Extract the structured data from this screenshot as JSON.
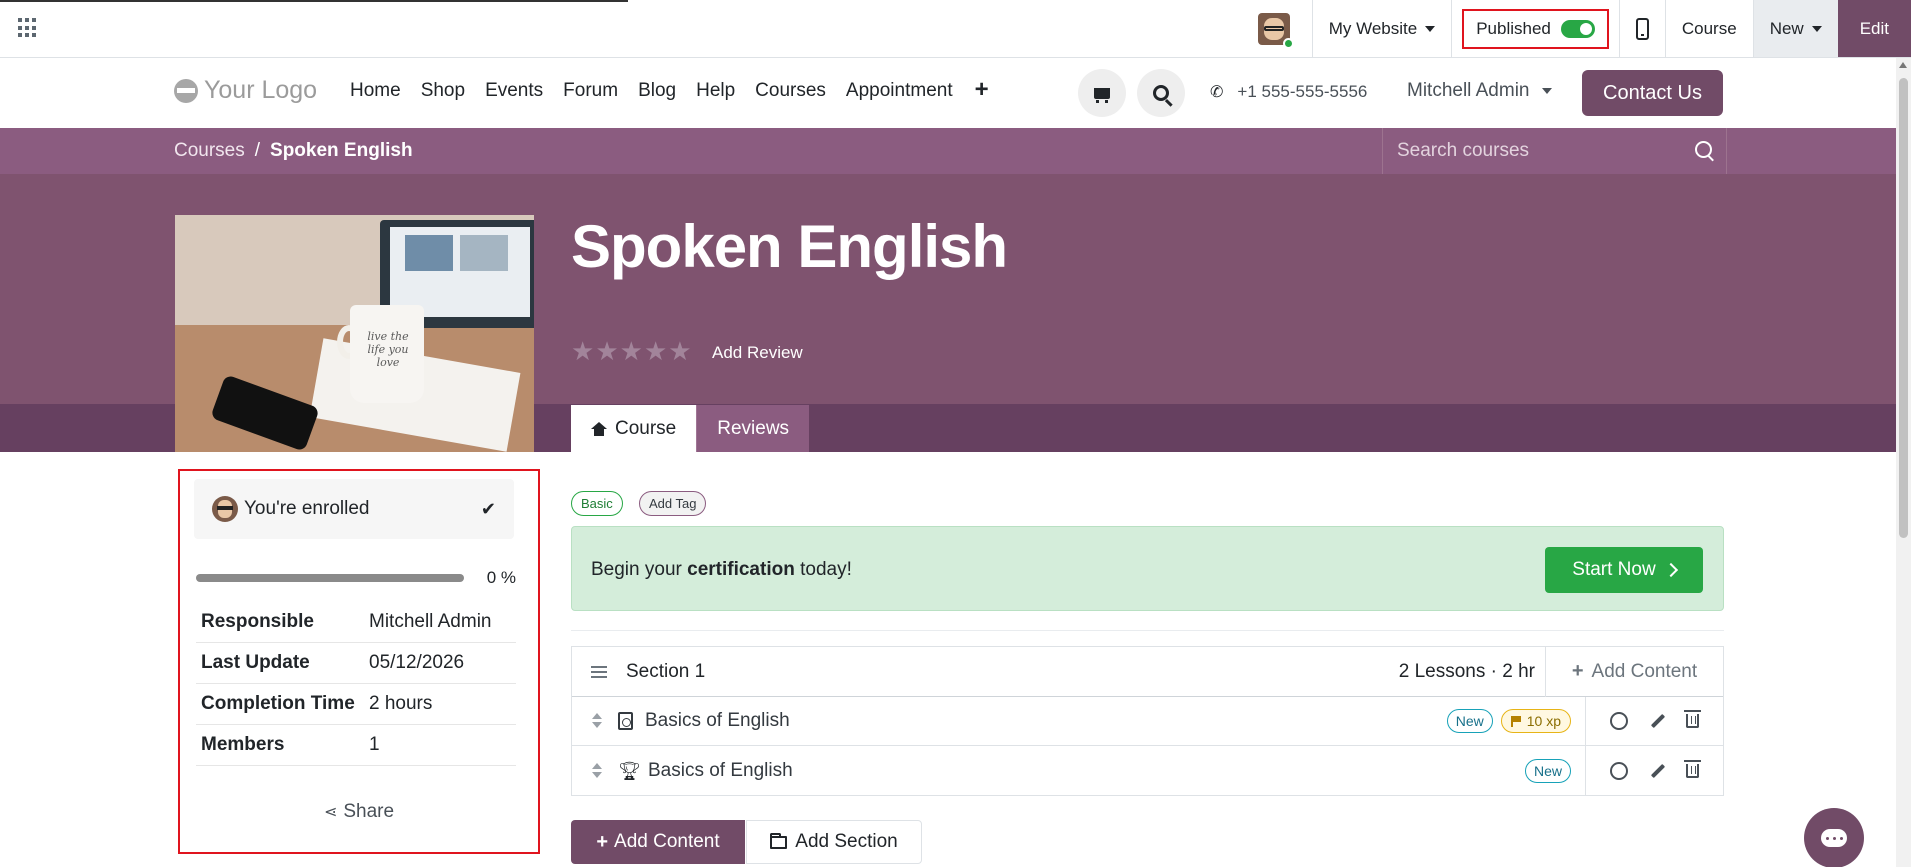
{
  "topbar": {
    "website_selector": "My Website",
    "published_label": "Published",
    "published_on": true,
    "course_label": "Course",
    "new_label": "New",
    "edit_label": "Edit"
  },
  "header": {
    "logo_text": "Your Logo",
    "nav": [
      "Home",
      "Shop",
      "Events",
      "Forum",
      "Blog",
      "Help",
      "Courses",
      "Appointment"
    ],
    "add_menu_icon": "plus-icon",
    "phone": "+1 555-555-5556",
    "user": "Mitchell Admin",
    "contact_label": "Contact Us"
  },
  "breadcrumb": {
    "root": "Courses",
    "separator": "/",
    "current": "Spoken English"
  },
  "course_search": {
    "placeholder": "Search courses"
  },
  "course": {
    "title": "Spoken English",
    "rating": 0,
    "max_rating": 5,
    "add_review": "Add Review",
    "image_mug_text": "live the life you love"
  },
  "tabs": [
    {
      "label": "Course",
      "active": true,
      "icon": "home-icon"
    },
    {
      "label": "Reviews",
      "active": false
    }
  ],
  "sidebar": {
    "enrolled_label": "You're enrolled",
    "progress_fraction": 0,
    "progress_label": "0 %",
    "details": [
      {
        "key": "Responsible",
        "value": "Mitchell Admin"
      },
      {
        "key": "Last Update",
        "value": "05/12/2026"
      },
      {
        "key": "Completion Time",
        "value": "2 hours"
      },
      {
        "key": "Members",
        "value": "1"
      }
    ],
    "share_label": "Share"
  },
  "tags": {
    "basic": "Basic",
    "add": "Add Tag"
  },
  "certification": {
    "prefix": "Begin your ",
    "bold": "certification",
    "suffix": " today!",
    "button": "Start Now"
  },
  "section": {
    "title": "Section 1",
    "summary": "2 Lessons · 2 hr",
    "add_content": "Add Content",
    "lessons": [
      {
        "name": "Basics of English",
        "type_icon": "pdf-icon",
        "new_badge": "New",
        "xp_badge": "10 xp"
      },
      {
        "name": "Basics of English",
        "type_icon": "trophy-icon",
        "new_badge": "New"
      }
    ]
  },
  "actions": {
    "add_content": "Add Content",
    "add_section": "Add Section"
  },
  "colors": {
    "brand": "#714b67",
    "banner": "#8b5c80",
    "success": "#28a745",
    "highlight_border": "#e0141e"
  }
}
